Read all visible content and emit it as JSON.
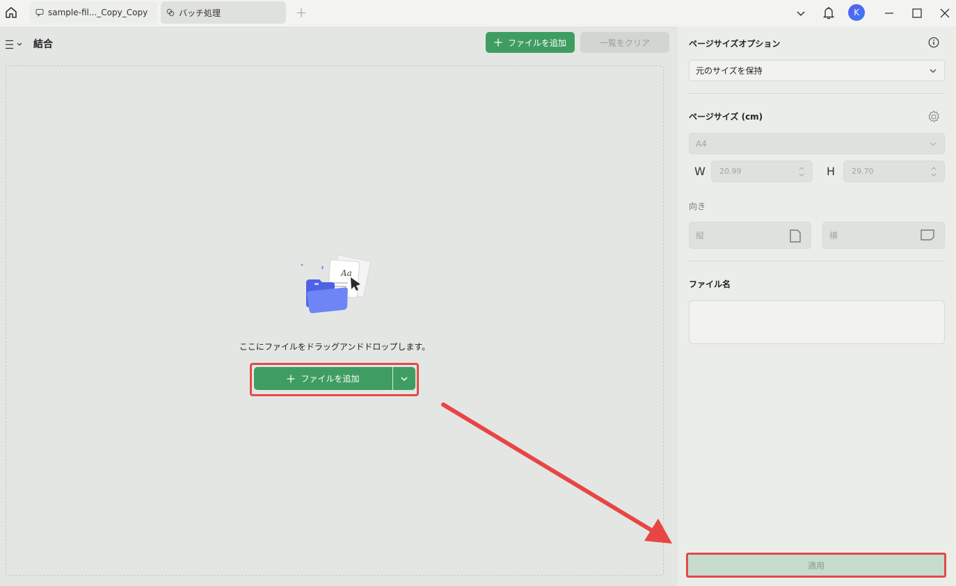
{
  "tabs": [
    {
      "label": "sample-fil..._Copy_Copy"
    },
    {
      "label": "バッチ処理"
    }
  ],
  "user": {
    "initial": "K"
  },
  "workspace": {
    "title": "結合",
    "add_file_label": "ファイルを追加",
    "clear_list_label": "一覧をクリア",
    "drop_text": "ここにファイルをドラッグアンドドロップします。",
    "add_file_main_label": "ファイルを追加"
  },
  "panel": {
    "page_size_option_title": "ページサイズオプション",
    "page_size_option_value": "元のサイズを保持",
    "page_size_title": "ページサイズ (cm)",
    "paper_value": "A4",
    "width_label": "W",
    "width_value": "20.99",
    "height_label": "H",
    "height_value": "29.70",
    "orientation_title": "向き",
    "portrait_label": "縦",
    "landscape_label": "横",
    "filename_title": "ファイル名",
    "filename_value": "",
    "apply_label": "適用"
  },
  "colors": {
    "accent_green": "#3f9d62",
    "highlight_red": "#e04a4a",
    "apply_disabled": "#c7dccd"
  }
}
